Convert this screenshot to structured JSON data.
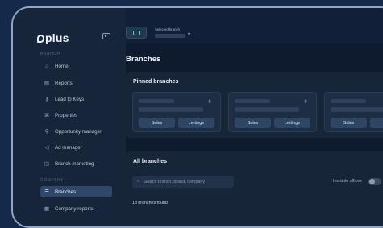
{
  "sidebar": {
    "logo": "plus",
    "sections": [
      "BRANCH",
      "COMPANY"
    ],
    "items": [
      {
        "label": "Home",
        "icon": "home-icon",
        "glyph": "⌂"
      },
      {
        "label": "Reports",
        "icon": "report-icon",
        "glyph": "▤"
      },
      {
        "label": "Lead to Keys",
        "icon": "key-icon",
        "glyph": "⚷"
      },
      {
        "label": "Properties",
        "icon": "properties-icon",
        "glyph": "⌘"
      },
      {
        "label": "Opportunity manager",
        "icon": "location-pin-icon",
        "glyph": "⚲"
      },
      {
        "label": "Ad manager",
        "icon": "megaphone-icon",
        "glyph": "◁"
      },
      {
        "label": "Branch marketing",
        "icon": "branch-marketing-icon",
        "glyph": "◫"
      },
      {
        "label": "Branches",
        "icon": "branches-icon",
        "glyph": "☰"
      },
      {
        "label": "Company reports",
        "icon": "company-reports-icon",
        "glyph": "▦"
      }
    ],
    "active": "Branches"
  },
  "header": {
    "selected_branch_label": "Selected branch",
    "page_title": "Branches"
  },
  "pinned": {
    "title": "Pinned branches",
    "cards": [
      {
        "buttons": [
          "Sales",
          "Lettings"
        ]
      },
      {
        "buttons": [
          "Sales",
          "Lettings"
        ]
      },
      {
        "buttons": [
          "Sales",
          "L"
        ]
      }
    ]
  },
  "all_branches": {
    "title": "All branches",
    "search_placeholder": "Search branch, brand, company",
    "invisible_offices_label": "Invisible offices",
    "invisible_offices_on": false,
    "results_count": "13 branches found"
  },
  "colors": {
    "background": "#15294a",
    "sidebar": "#17253a",
    "active_item": "#30476a",
    "accent_teal": "#6fc2ba"
  }
}
